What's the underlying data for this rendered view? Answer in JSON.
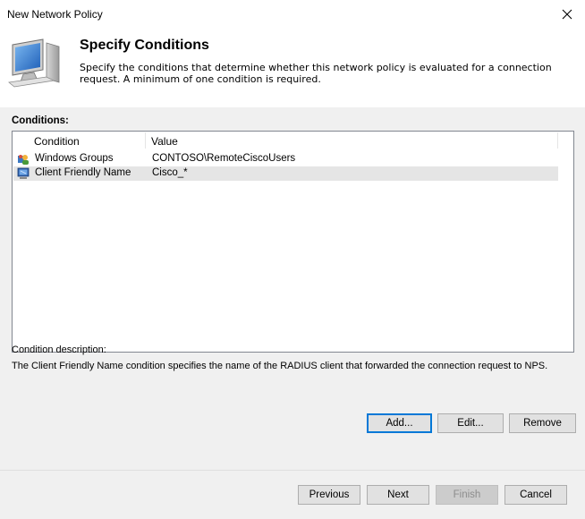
{
  "window": {
    "title": "New Network Policy"
  },
  "header": {
    "title": "Specify Conditions",
    "description": "Specify the conditions that determine whether this network policy is evaluated for a connection request. A minimum of one condition is required."
  },
  "conditions": {
    "label": "Conditions:",
    "columns": [
      "Condition",
      "Value"
    ],
    "rows": [
      {
        "icon": "windows-groups-icon",
        "condition": "Windows Groups",
        "value": "CONTOSO\\RemoteCiscoUsers",
        "selected": false
      },
      {
        "icon": "client-friendly-name-icon",
        "condition": "Client Friendly Name",
        "value": "Cisco_*",
        "selected": true
      }
    ]
  },
  "description": {
    "label": "Condition description:",
    "text": "The Client Friendly Name condition specifies the name of the RADIUS client that forwarded the connection request to NPS."
  },
  "buttons": {
    "add": "Add...",
    "edit": "Edit...",
    "remove": "Remove",
    "previous": "Previous",
    "next": "Next",
    "finish": "Finish",
    "cancel": "Cancel"
  }
}
